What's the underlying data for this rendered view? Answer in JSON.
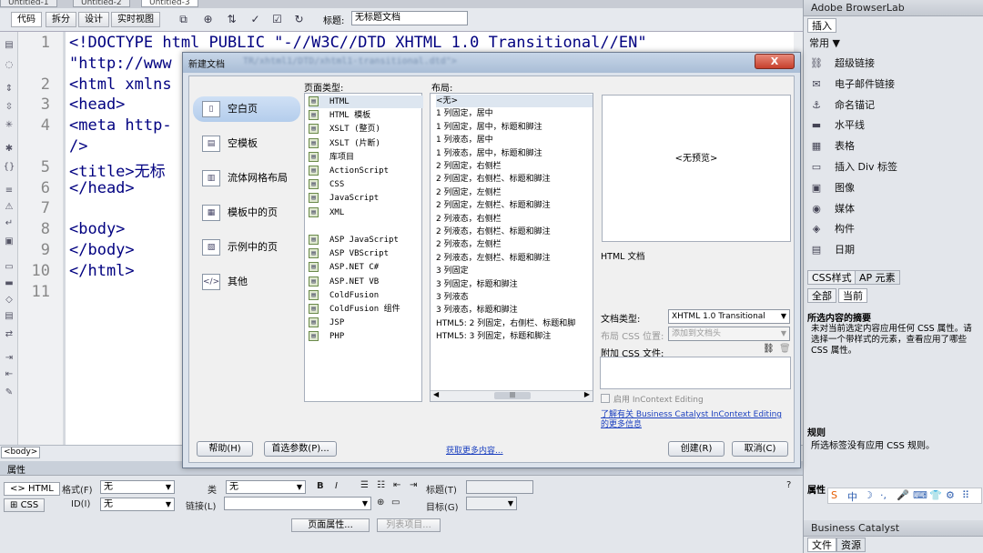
{
  "doc_tabs": [
    "Untitled-1",
    "Untitled-2",
    "Untitled-3"
  ],
  "toolbar": {
    "code": "代码",
    "split": "拆分",
    "design": "设计",
    "live": "实时视图",
    "title_label": "标题:",
    "title_value": "无标题文档"
  },
  "code_lines": [
    {
      "n": "1",
      "text": "<!DOCTYPE html PUBLIC \"-//W3C//DTD XHTML 1.0 Transitional//EN\""
    },
    {
      "n": "",
      "text": "\"http://www"
    },
    {
      "n": "2",
      "text": "<html xmlns"
    },
    {
      "n": "3",
      "text": "<head>"
    },
    {
      "n": "4",
      "text": "<meta http-"
    },
    {
      "n": "",
      "text": "/>"
    },
    {
      "n": "5",
      "text": "<title>无标"
    },
    {
      "n": "6",
      "text": "</head>"
    },
    {
      "n": "7",
      "text": ""
    },
    {
      "n": "8",
      "text": "<body>"
    },
    {
      "n": "9",
      "text": "</body>"
    },
    {
      "n": "10",
      "text": "</html>"
    },
    {
      "n": "11",
      "text": ""
    }
  ],
  "status": {
    "tag": "<body>"
  },
  "properties": {
    "header": "属性",
    "html_btn": "HTML",
    "css_btn": "CSS",
    "format_label": "格式(F)",
    "format_value": "无",
    "class_label": "类",
    "class_value": "无",
    "id_label": "ID(I)",
    "id_value": "无",
    "link_label": "链接(L)",
    "title_label": "标题(T)",
    "target_label": "目标(G)",
    "page_props_btn": "页面属性...",
    "list_item_btn": "列表项目..."
  },
  "right_panel": {
    "browserlab": "Adobe BrowserLab",
    "insert_tab": "插入",
    "common": "常用",
    "items": [
      {
        "icon": "hyperlink-icon",
        "glyph": "⛓",
        "label": "超级链接"
      },
      {
        "icon": "email-icon",
        "glyph": "✉",
        "label": "电子邮件链接"
      },
      {
        "icon": "anchor-icon",
        "glyph": "⚓",
        "label": "命名锚记"
      },
      {
        "icon": "hr-icon",
        "glyph": "▬",
        "label": "水平线"
      },
      {
        "icon": "table-icon",
        "glyph": "▦",
        "label": "表格"
      },
      {
        "icon": "div-icon",
        "glyph": "▭",
        "label": "插入 Div 标签"
      },
      {
        "icon": "image-icon",
        "glyph": "▣",
        "label": "图像"
      },
      {
        "icon": "media-icon",
        "glyph": "◉",
        "label": "媒体"
      },
      {
        "icon": "widget-icon",
        "glyph": "◈",
        "label": "构件"
      },
      {
        "icon": "date-icon",
        "glyph": "▤",
        "label": "日期"
      }
    ],
    "css_tab": "CSS样式",
    "ap_tab": "AP 元素",
    "all_btn": "全部",
    "current_btn": "当前",
    "summary_title": "所选内容的摘要",
    "summary_text": "未对当前选定内容应用任何 CSS 属性。请选择一个带样式的元素，查看应用了哪些 CSS 属性。",
    "rules_title": "规则",
    "rules_text": "所选标签没有应用 CSS 规则。",
    "props_title": "属性",
    "bc": "Business Catalyst",
    "files_tab": "文件",
    "assets_tab": "资源",
    "ime_glyphs": [
      "S",
      "中",
      "☽",
      "·,",
      "🎤",
      "⌨",
      "👕",
      "⚙",
      "⠿"
    ]
  },
  "dialog": {
    "title": "新建文档",
    "url_fragment": "TR/xhtml1/DTD/xhtml1-transitional.dtd\">",
    "close": "X",
    "categories": [
      {
        "label": "空白页",
        "icon": "blank-page-icon",
        "glyph": "▯"
      },
      {
        "label": "空模板",
        "icon": "blank-template-icon",
        "glyph": "▤"
      },
      {
        "label": "流体网格布局",
        "icon": "fluid-grid-icon",
        "glyph": "▥"
      },
      {
        "label": "模板中的页",
        "icon": "template-page-icon",
        "glyph": "▦"
      },
      {
        "label": "示例中的页",
        "icon": "sample-page-icon",
        "glyph": "▧"
      },
      {
        "label": "其他",
        "icon": "other-icon",
        "glyph": "</>"
      }
    ],
    "page_type_label": "页面类型:",
    "page_types": [
      "HTML",
      "HTML 模板",
      "XSLT (整页)",
      "XSLT (片断)",
      "库项目",
      "ActionScript",
      "CSS",
      "JavaScript",
      "XML",
      "",
      "ASP JavaScript",
      "ASP VBScript",
      "ASP.NET C#",
      "ASP.NET VB",
      "ColdFusion",
      "ColdFusion 组件",
      "JSP",
      "PHP"
    ],
    "layout_label": "布局:",
    "layouts": [
      "<无>",
      "1 列固定，居中",
      "1 列固定，居中，标题和脚注",
      "1 列液态，居中",
      "1 列液态，居中，标题和脚注",
      "2 列固定，右侧栏",
      "2 列固定，右侧栏、标题和脚注",
      "2 列固定，左侧栏",
      "2 列固定，左侧栏、标题和脚注",
      "2 列液态，右侧栏",
      "2 列液态，右侧栏、标题和脚注",
      "2 列液态，左侧栏",
      "2 列液态，左侧栏、标题和脚注",
      "3 列固定",
      "3 列固定，标题和脚注",
      "3 列液态",
      "3 列液态，标题和脚注",
      "HTML5: 2 列固定，右侧栏、标题和脚",
      "HTML5: 3 列固定，标题和脚注"
    ],
    "preview_text": "<无预览>",
    "desc": "HTML 文档",
    "doctype_label": "文档类型:",
    "doctype_value": "XHTML 1.0 Transitional",
    "layout_css_label": "布局 CSS 位置:",
    "layout_css_value": "添加到文档头",
    "attach_css_label": "附加 CSS 文件:",
    "incontext_label": "启用 InContext Editing",
    "bc_link": "了解有关 Business Catalyst InContext Editing 的更多信息",
    "help_btn": "帮助(H)",
    "prefs_btn": "首选参数(P)...",
    "more_link": "获取更多内容...",
    "create_btn": "创建(R)",
    "cancel_btn": "取消(C)"
  }
}
